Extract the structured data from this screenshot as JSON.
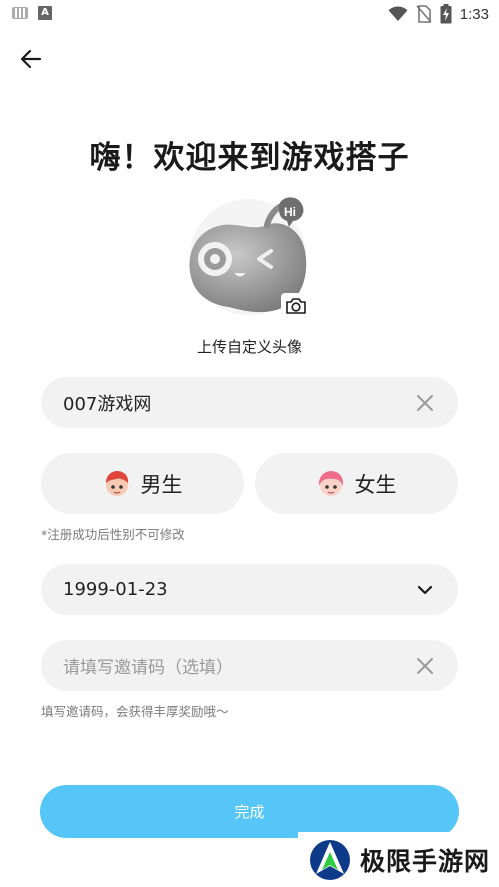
{
  "status_bar": {
    "time": "1:33",
    "left_icons": [
      "keyboard-icon",
      "a-icon"
    ],
    "right_icons": [
      "wifi-icon",
      "no-sim-icon",
      "battery-charging-icon"
    ]
  },
  "header": {
    "back_icon": "arrow-left-icon"
  },
  "title": "嗨！欢迎来到游戏搭子",
  "avatar": {
    "upload_label": "上传自定义头像",
    "badge_text": "Hi",
    "camera_icon": "camera-icon"
  },
  "form": {
    "nickname": {
      "value": "007游戏网",
      "clear_icon": "close-icon"
    },
    "gender": {
      "male_label": "男生",
      "female_label": "女生",
      "hint": "*注册成功后性别不可修改"
    },
    "birthday": {
      "value": "1999-01-23",
      "dropdown_icon": "chevron-down-icon"
    },
    "invite_code": {
      "placeholder": "请填写邀请码（选填）",
      "clear_icon": "close-icon",
      "hint": "填写邀请码，会获得丰厚奖励哦～"
    },
    "submit_label": "完成"
  },
  "watermark": {
    "text": "极限手游网"
  },
  "colors": {
    "accent": "#56c5f8",
    "field_bg": "#f2f2f2",
    "hint_text": "#7a7a7a"
  }
}
